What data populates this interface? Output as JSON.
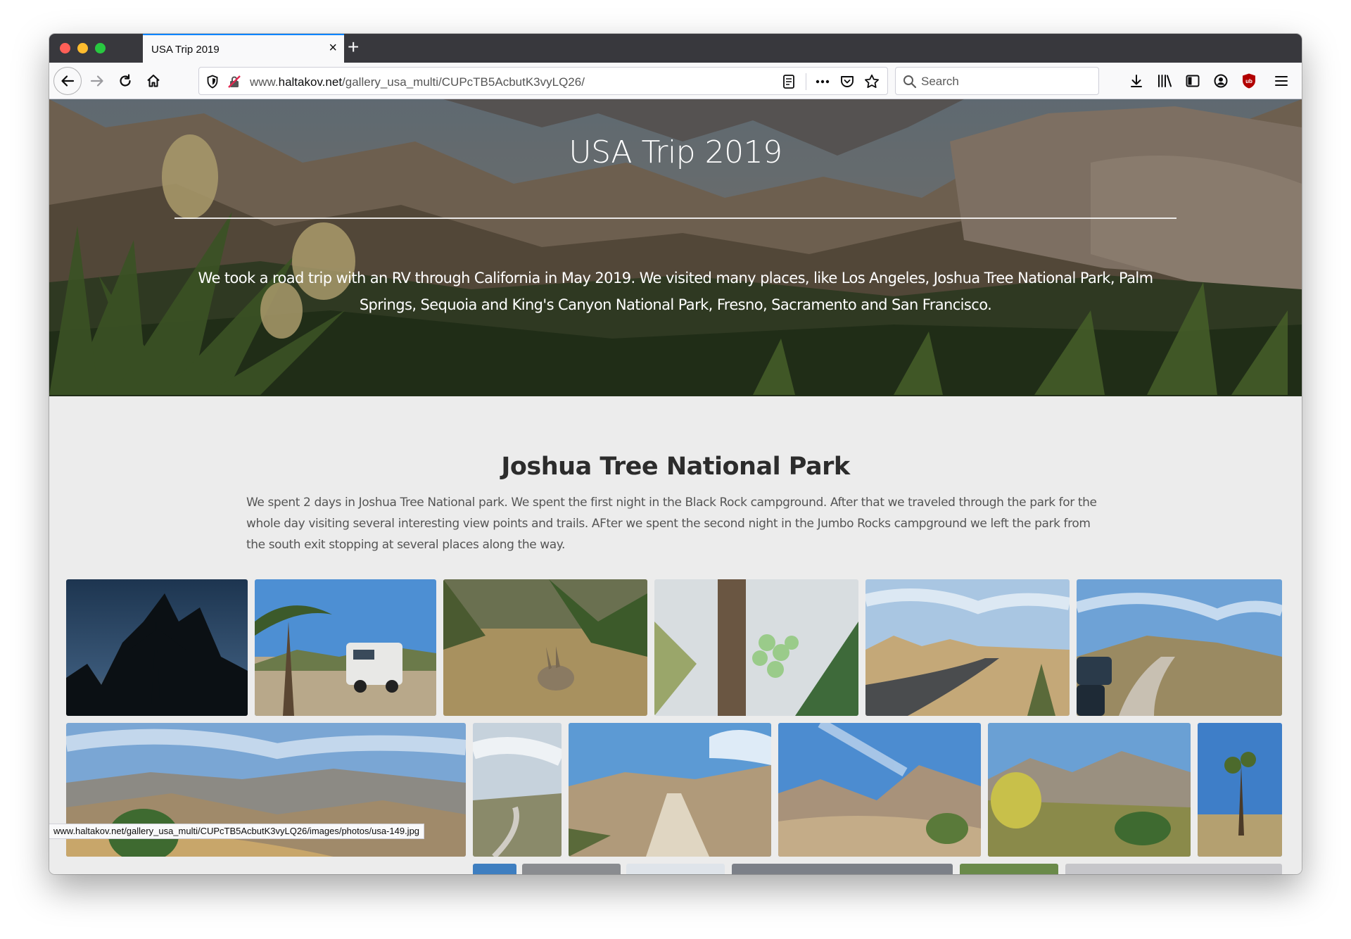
{
  "browser": {
    "tab_title": "USA Trip 2019",
    "tab_close": "×",
    "new_tab": "+",
    "url_prefix": "www.",
    "url_domain": "haltakov.net",
    "url_path": "/gallery_usa_multi/CUPcTB5AcbutK3vyLQ26/",
    "search_placeholder": "Search",
    "status_url": "www.haltakov.net/gallery_usa_multi/CUPcTB5AcbutK3vyLQ26/images/photos/usa-149.jpg"
  },
  "hero": {
    "title": "USA Trip 2019",
    "description": "We took a road trip with an RV through California in May 2019. We visited many places, like Los Angeles, Joshua Tree National Park, Palm Springs, Sequoia and King's Canyon National Park, Fresno, Sacramento and San Francisco."
  },
  "section": {
    "title": "Joshua Tree National Park",
    "description": "We spent 2 days in Joshua Tree National park. We spent the first night in the Black Rock campground. After that we traveled through the park for the whole day visiting several interesting view points and trails. AFter we spent the second night in the Jumbo Rocks campground we left the park from the south exit stopping at several places along the way."
  },
  "colors": {
    "tab_accent": "#0a84ff",
    "ublock_red": "#b20000"
  }
}
